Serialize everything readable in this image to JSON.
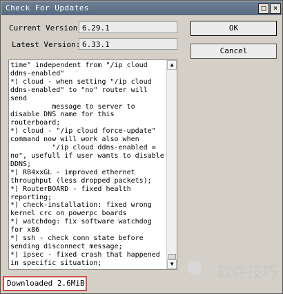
{
  "window": {
    "title": "Check For Updates",
    "controls": {
      "restore": "□",
      "close": "×"
    }
  },
  "fields": {
    "current_version": {
      "label": "Current Version:",
      "value": "6.29.1"
    },
    "latest_version": {
      "label": "Latest Version:",
      "value": "6.33.1"
    }
  },
  "buttons": {
    "ok": "OK",
    "cancel": "Cancel"
  },
  "changelog": {
    "text": "time\" independent from \"/ip cloud\nddns-enabled\"\n*) cloud - when setting \"/ip cloud\nddns-enabled\" to \"no\" router will\nsend\n          message to server to\ndisable DNS name for this\nrouterboard;\n*) cloud - \"/ip cloud force-update\"\ncommand now will work also when\n          \"/ip cloud ddns-enabled =\nno\", usefull if user wants to disable\nDDNS;\n*) RB4xxGL - improved ethernet\nthroughput (less dropped packets);\n*) RouterBOARD - fixed health\nreporting;\n*) check-installation: fixed wrong\nkernel crc on powerpc boards\n*) watchdog: fix software watchdog\nfor x86\n*) ssh - check conn state before\nsending disconnect message;\n*) ipsec - fixed crash that happened\nin specific situation;"
  },
  "status": {
    "text": "Downloaded 2.6MiB"
  },
  "watermark": {
    "text": "软件技巧"
  }
}
